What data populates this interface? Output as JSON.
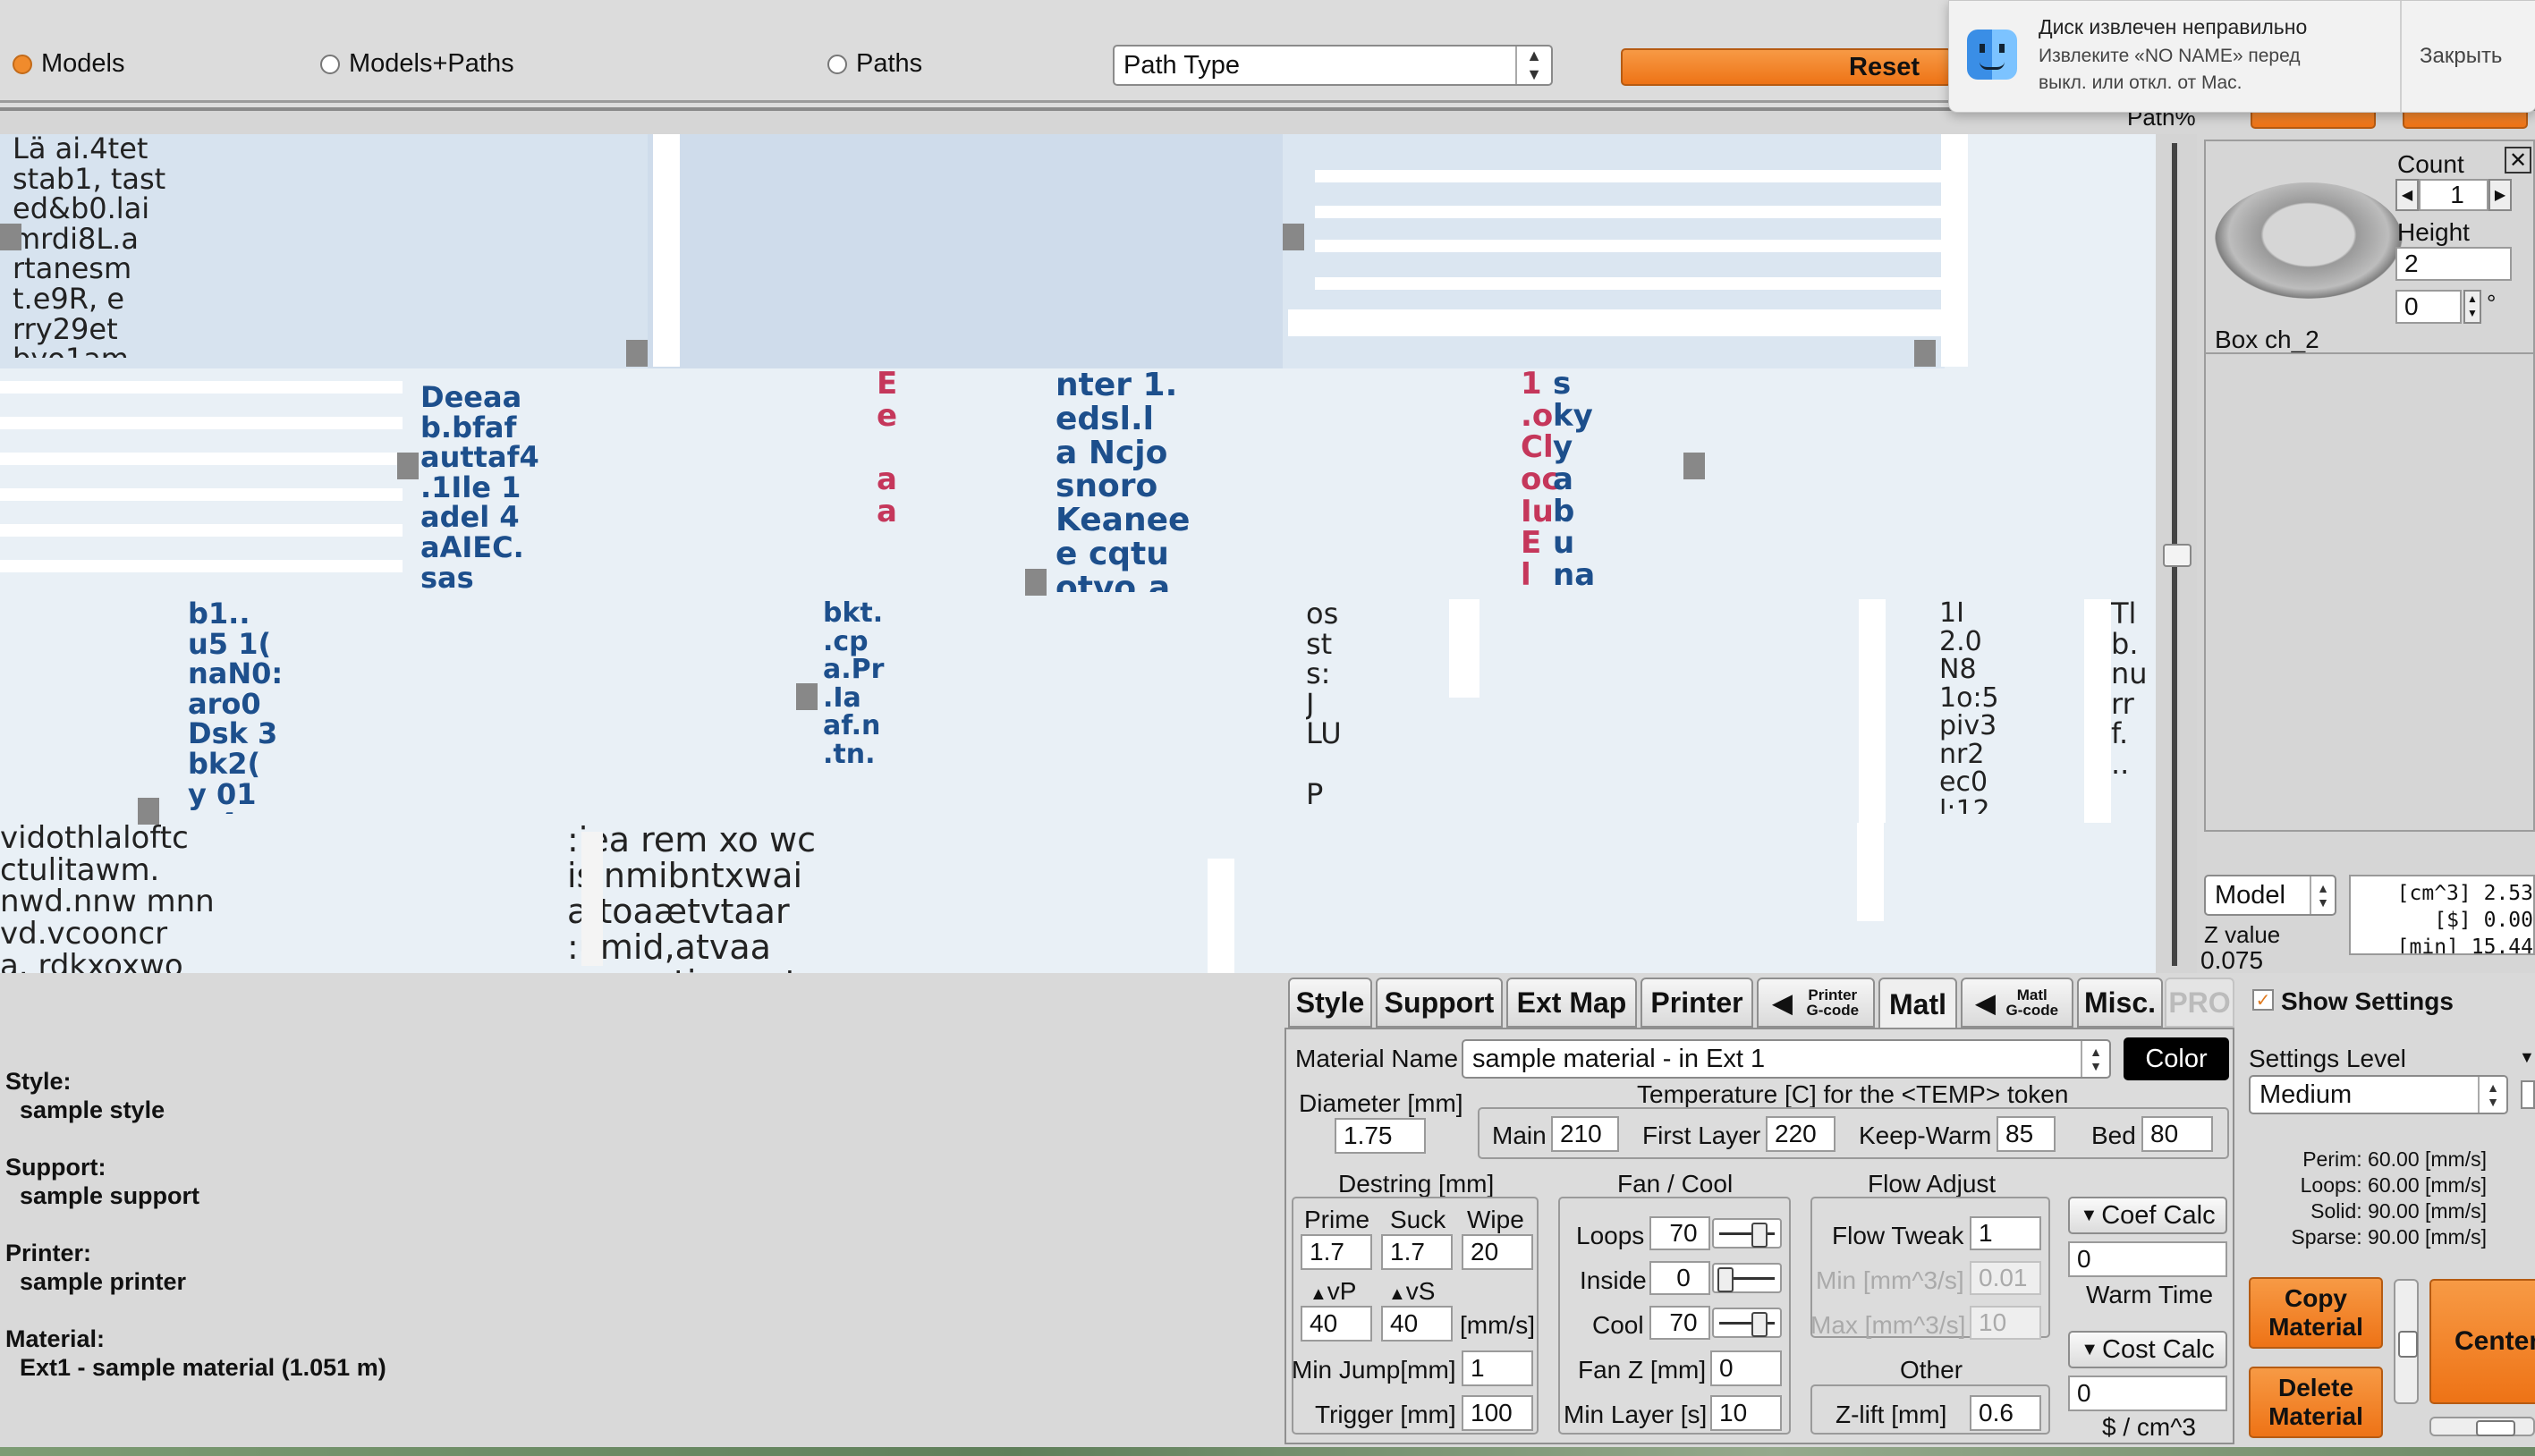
{
  "toolbar": {
    "radio_models": "Models",
    "radio_models_paths": "Models+Paths",
    "radio_paths": "Paths",
    "path_type": "Path Type",
    "reset": "Reset",
    "path_pct": "Path%"
  },
  "notification": {
    "title": "Диск извлечен неправильно",
    "body_line1": "Извлеките «NO NAME» перед",
    "body_line2": "выкл. или откл. от Mac.",
    "close": "Закрыть"
  },
  "model_panel": {
    "count_label": "Count",
    "count_value": "1",
    "height_label": "Height",
    "height_value": "2",
    "rotation_value": "0",
    "degree": "°",
    "model_name": "Box ch_2",
    "view_select": "Model",
    "stats_line1": "[cm^3] 2.53",
    "stats_line2": "[$] 0.00",
    "stats_line3": "[min] 15.44",
    "z_label": "Z value",
    "z_value": "0.075"
  },
  "summary": {
    "style_label": "Style:",
    "style_value": "sample style",
    "support_label": "Support:",
    "support_value": "sample support",
    "printer_label": "Printer:",
    "printer_value": "sample printer",
    "material_label": "Material:",
    "material_value": "Ext1 - sample material (1.051 m)"
  },
  "tabs": {
    "style": "Style",
    "support": "Support",
    "extmap": "Ext Map",
    "printer": "Printer",
    "printer_gcode_1": "Printer",
    "printer_gcode_2": "G-code",
    "matl": "Matl",
    "matl_gcode_1": "Matl",
    "matl_gcode_2": "G-code",
    "misc": "Misc.",
    "pro": "PRO"
  },
  "material": {
    "name_label": "Material Name",
    "name_value": "sample material - in Ext 1",
    "color_button": "Color",
    "diameter_label": "Diameter [mm]",
    "diameter_value": "1.75",
    "temp_title": "Temperature [C] for the <TEMP> token",
    "main_label": "Main",
    "main_value": "210",
    "first_layer_label": "First Layer",
    "first_layer_value": "220",
    "keep_warm_label": "Keep-Warm",
    "keep_warm_value": "85",
    "bed_label": "Bed",
    "bed_value": "80"
  },
  "destring": {
    "title": "Destring [mm]",
    "prime_label": "Prime",
    "prime_value": "1.7",
    "suck_label": "Suck",
    "suck_value": "1.7",
    "wipe_label": "Wipe",
    "wipe_value": "20",
    "vp_label": "vP",
    "vs_label": "vS",
    "vp_value": "40",
    "vs_value": "40",
    "speed_unit": "[mm/s]",
    "min_jump_label": "Min Jump[mm]",
    "min_jump_value": "1",
    "trigger_label": "Trigger [mm]",
    "trigger_value": "100"
  },
  "fan": {
    "title": "Fan / Cool",
    "loops_label": "Loops",
    "loops_value": "70",
    "inside_label": "Inside",
    "inside_value": "0",
    "cool_label": "Cool",
    "cool_value": "70",
    "fanz_label": "Fan Z [mm]",
    "fanz_value": "0",
    "min_layer_label": "Min Layer [s]",
    "min_layer_value": "10",
    "loops_level": 0.7,
    "inside_level": 0.0,
    "cool_level": 0.7
  },
  "flow": {
    "title": "Flow Adjust",
    "tweak_label": "Flow Tweak",
    "tweak_value": "1",
    "min_label": "Min [mm^3/s]",
    "min_value": "0.01",
    "max_label": "Max [mm^3/s]",
    "max_value": "10",
    "other_title": "Other",
    "zlift_label": "Z-lift [mm]",
    "zlift_value": "0.6"
  },
  "calc": {
    "coef_button": "Coef Calc",
    "coef_value": "0",
    "warm_time_label": "Warm Time",
    "cost_button": "Cost Calc",
    "cost_value": "0",
    "cost_unit": "$ / cm^3",
    "copy_1": "Copy",
    "copy_2": "Material",
    "delete_1": "Delete",
    "delete_2": "Material"
  },
  "settings": {
    "show_label": "Show Settings",
    "level_label": "Settings Level",
    "level_value": "Medium",
    "perim": "Perim:  60.00 [mm/s]",
    "loops": "Loops:  60.00 [mm/s]",
    "solid": "Solid:  90.00 [mm/s]",
    "sparse": "Sparse: 90.00 [mm/s]",
    "center": "Center"
  },
  "colors": {
    "accent_orange": "#f08b2c",
    "canvas_bg": "#e9f0f6",
    "panel_bg": "#d8d8d8",
    "text_blue": "#1d4f8c"
  }
}
